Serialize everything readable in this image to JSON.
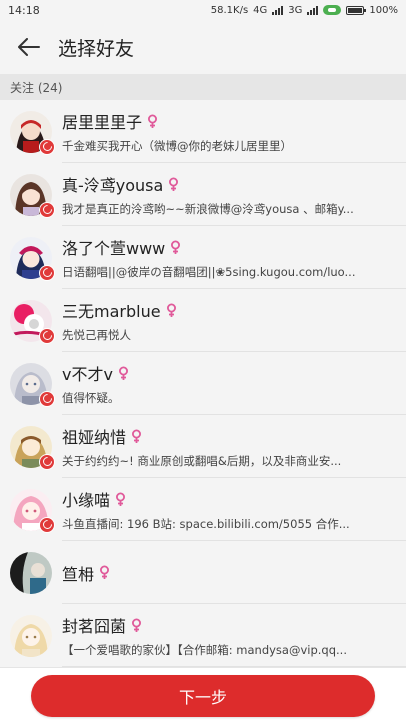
{
  "statusbar": {
    "time": "14:18",
    "speed": "58.1K/s",
    "network1": "4G",
    "network2": "3G",
    "battery": "100%"
  },
  "header": {
    "title": "选择好友"
  },
  "section": {
    "label": "关注 (24)"
  },
  "friends": [
    {
      "name": "居里里里子",
      "desc": "千金难买我开心（微博@你的老妹儿居里里）"
    },
    {
      "name": "真-泠鸢yousa",
      "desc": "我才是真正的泠鸢哟~~新浪微博@泠鸢yousa 、邮箱y..."
    },
    {
      "name": "洛了个萱www",
      "desc": "日语翻唱||@彼岸の音翻唱团||❀5sing.kugou.com/luo..."
    },
    {
      "name": "三无marblue",
      "desc": "先悦己再悦人"
    },
    {
      "name": "v不才v",
      "desc": "值得怀疑。"
    },
    {
      "name": "祖娅纳惜",
      "desc": "关于约约约~! 商业原创或翻唱&后期，以及非商业安..."
    },
    {
      "name": "小缘喵",
      "desc": "斗鱼直播间: 196 B站: space.bilibili.com/5055 合作..."
    },
    {
      "name": "笪枏",
      "desc": ""
    },
    {
      "name": "封茗囧菌",
      "desc": "【一个爱唱歌的家伙】【合作邮箱: mandysa@vip.qq..."
    }
  ],
  "footer": {
    "next_label": "下一步"
  },
  "colors": {
    "accent": "#dd2c2c",
    "female_icon": "#e05a9a"
  }
}
